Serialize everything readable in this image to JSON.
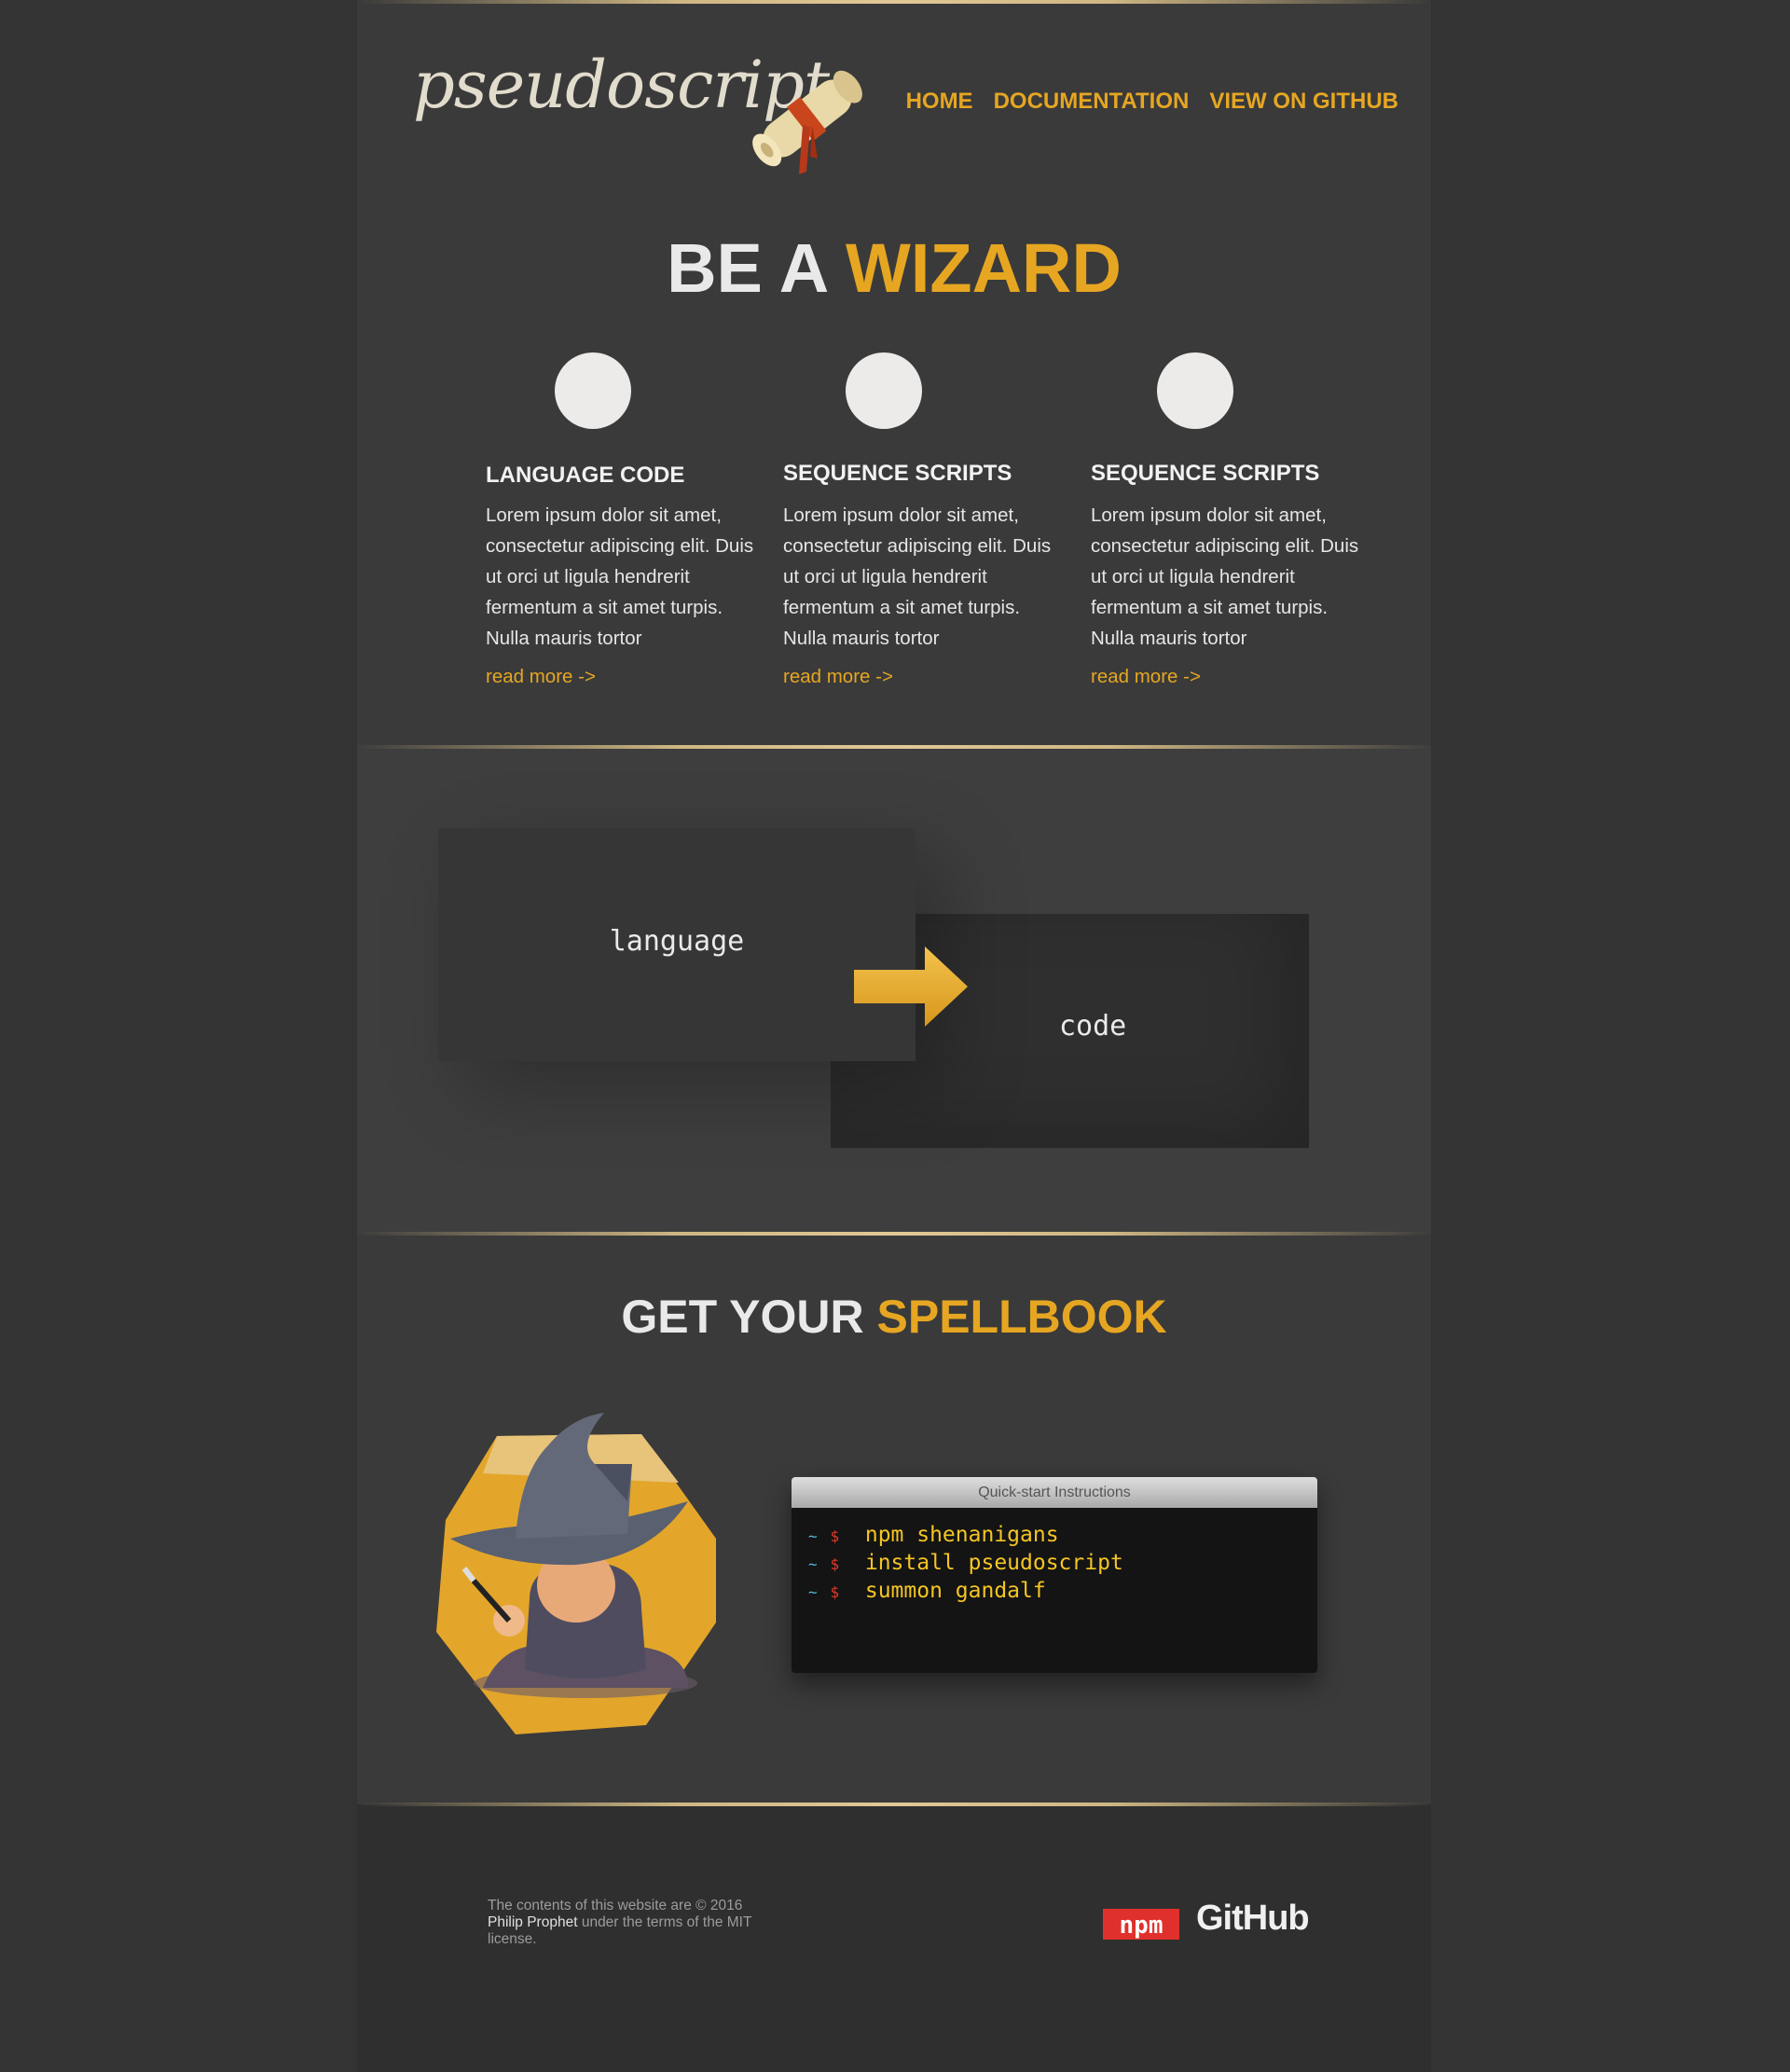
{
  "header": {
    "logo": "pseudoscript",
    "nav": [
      "HOME",
      "DOCUMENTATION",
      "VIEW ON GITHUB"
    ]
  },
  "hero": {
    "title_plain": "BE A",
    "title_accent": "WIZARD"
  },
  "features": [
    {
      "title": "LANGUAGE CODE",
      "text": "Lorem ipsum dolor sit amet, consectetur adipiscing elit. Duis ut orci ut ligula hendrerit fermentum a sit amet turpis. Nulla mauris tortor",
      "link": "read more ->"
    },
    {
      "title": "SEQUENCE SCRIPTS",
      "text": "Lorem ipsum dolor sit amet, consectetur adipiscing elit. Duis ut orci ut ligula hendrerit fermentum a sit amet turpis. Nulla mauris tortor",
      "link": "read more ->"
    },
    {
      "title": "SEQUENCE SCRIPTS",
      "text": "Lorem ipsum dolor sit amet, consectetur adipiscing elit. Duis ut orci ut ligula hendrerit fermentum a sit amet turpis. Nulla mauris tortor",
      "link": "read more ->"
    }
  ],
  "diagram": {
    "left_label": "language",
    "right_label": "code"
  },
  "spellbook": {
    "title_plain": "GET YOUR",
    "title_accent": "SPELLBOOK",
    "terminal_title": "Quick-start Instructions",
    "prompt_tilde": "~",
    "prompt_dollar": "$",
    "commands": [
      "npm shenanigans",
      "install pseudoscript",
      "summon gandalf"
    ]
  },
  "footer": {
    "copyright_prefix": "The contents of this website are © 2016",
    "author": "Philip Prophet",
    "copyright_suffix": " under the terms of the MIT license.",
    "npm_label": "npm",
    "github_label": "GitHub"
  },
  "colors": {
    "accent": "#e6a622",
    "background": "#333333",
    "panel": "#3a3a3a"
  }
}
